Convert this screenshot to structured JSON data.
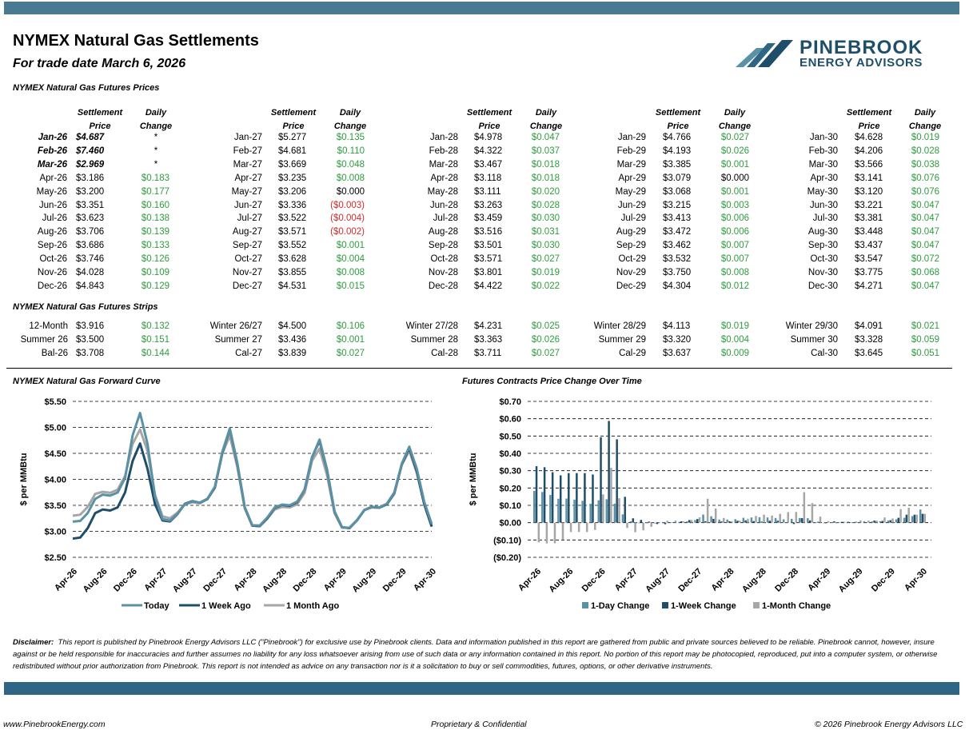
{
  "header": {
    "title": "NYMEX Natural Gas Settlements",
    "subtitle": "For trade date March 6, 2026",
    "brand": "PINEBROOK",
    "brand_tag": "ENERGY ADVISORS"
  },
  "prices": {
    "section_title": "NYMEX Natural Gas Futures Prices",
    "col_headers": {
      "settle1": "Settlement",
      "settle2": "Price",
      "change1": "Daily",
      "change2": "Change"
    },
    "columns": [
      {
        "rows": [
          {
            "label": "Jan-26",
            "price": "$4.687",
            "change": "*",
            "expired": true
          },
          {
            "label": "Feb-26",
            "price": "$7.460",
            "change": "*",
            "expired": true
          },
          {
            "label": "Mar-26",
            "price": "$2.969",
            "change": "*",
            "expired": true
          },
          {
            "label": "Apr-26",
            "price": "$3.186",
            "change": "$0.183"
          },
          {
            "label": "May-26",
            "price": "$3.200",
            "change": "$0.177"
          },
          {
            "label": "Jun-26",
            "price": "$3.351",
            "change": "$0.160"
          },
          {
            "label": "Jul-26",
            "price": "$3.623",
            "change": "$0.138"
          },
          {
            "label": "Aug-26",
            "price": "$3.706",
            "change": "$0.139"
          },
          {
            "label": "Sep-26",
            "price": "$3.686",
            "change": "$0.133"
          },
          {
            "label": "Oct-26",
            "price": "$3.746",
            "change": "$0.126"
          },
          {
            "label": "Nov-26",
            "price": "$4.028",
            "change": "$0.109"
          },
          {
            "label": "Dec-26",
            "price": "$4.843",
            "change": "$0.129"
          }
        ]
      },
      {
        "rows": [
          {
            "label": "Jan-27",
            "price": "$5.277",
            "change": "$0.135"
          },
          {
            "label": "Feb-27",
            "price": "$4.681",
            "change": "$0.110"
          },
          {
            "label": "Mar-27",
            "price": "$3.669",
            "change": "$0.048"
          },
          {
            "label": "Apr-27",
            "price": "$3.235",
            "change": "$0.008"
          },
          {
            "label": "May-27",
            "price": "$3.206",
            "change": "$0.000"
          },
          {
            "label": "Jun-27",
            "price": "$3.336",
            "change": "($0.003)"
          },
          {
            "label": "Jul-27",
            "price": "$3.522",
            "change": "($0.004)"
          },
          {
            "label": "Aug-27",
            "price": "$3.571",
            "change": "($0.002)"
          },
          {
            "label": "Sep-27",
            "price": "$3.552",
            "change": "$0.001"
          },
          {
            "label": "Oct-27",
            "price": "$3.628",
            "change": "$0.004"
          },
          {
            "label": "Nov-27",
            "price": "$3.855",
            "change": "$0.008"
          },
          {
            "label": "Dec-27",
            "price": "$4.531",
            "change": "$0.015"
          }
        ]
      },
      {
        "rows": [
          {
            "label": "Jan-28",
            "price": "$4.978",
            "change": "$0.047"
          },
          {
            "label": "Feb-28",
            "price": "$4.322",
            "change": "$0.037"
          },
          {
            "label": "Mar-28",
            "price": "$3.467",
            "change": "$0.018"
          },
          {
            "label": "Apr-28",
            "price": "$3.118",
            "change": "$0.018"
          },
          {
            "label": "May-28",
            "price": "$3.111",
            "change": "$0.020"
          },
          {
            "label": "Jun-28",
            "price": "$3.263",
            "change": "$0.028"
          },
          {
            "label": "Jul-28",
            "price": "$3.459",
            "change": "$0.030"
          },
          {
            "label": "Aug-28",
            "price": "$3.516",
            "change": "$0.031"
          },
          {
            "label": "Sep-28",
            "price": "$3.501",
            "change": "$0.030"
          },
          {
            "label": "Oct-28",
            "price": "$3.571",
            "change": "$0.027"
          },
          {
            "label": "Nov-28",
            "price": "$3.801",
            "change": "$0.019"
          },
          {
            "label": "Dec-28",
            "price": "$4.422",
            "change": "$0.022"
          }
        ]
      },
      {
        "rows": [
          {
            "label": "Jan-29",
            "price": "$4.766",
            "change": "$0.027"
          },
          {
            "label": "Feb-29",
            "price": "$4.193",
            "change": "$0.026"
          },
          {
            "label": "Mar-29",
            "price": "$3.385",
            "change": "$0.001"
          },
          {
            "label": "Apr-29",
            "price": "$3.079",
            "change": "$0.000"
          },
          {
            "label": "May-29",
            "price": "$3.068",
            "change": "$0.001"
          },
          {
            "label": "Jun-29",
            "price": "$3.215",
            "change": "$0.003"
          },
          {
            "label": "Jul-29",
            "price": "$3.413",
            "change": "$0.006"
          },
          {
            "label": "Aug-29",
            "price": "$3.472",
            "change": "$0.006"
          },
          {
            "label": "Sep-29",
            "price": "$3.462",
            "change": "$0.007"
          },
          {
            "label": "Oct-29",
            "price": "$3.532",
            "change": "$0.007"
          },
          {
            "label": "Nov-29",
            "price": "$3.750",
            "change": "$0.008"
          },
          {
            "label": "Dec-29",
            "price": "$4.304",
            "change": "$0.012"
          }
        ]
      },
      {
        "rows": [
          {
            "label": "Jan-30",
            "price": "$4.628",
            "change": "$0.019"
          },
          {
            "label": "Feb-30",
            "price": "$4.206",
            "change": "$0.028"
          },
          {
            "label": "Mar-30",
            "price": "$3.566",
            "change": "$0.038"
          },
          {
            "label": "Apr-30",
            "price": "$3.141",
            "change": "$0.076"
          },
          {
            "label": "May-30",
            "price": "$3.120",
            "change": "$0.076"
          },
          {
            "label": "Jun-30",
            "price": "$3.221",
            "change": "$0.047"
          },
          {
            "label": "Jul-30",
            "price": "$3.381",
            "change": "$0.047"
          },
          {
            "label": "Aug-30",
            "price": "$3.448",
            "change": "$0.047"
          },
          {
            "label": "Sep-30",
            "price": "$3.437",
            "change": "$0.047"
          },
          {
            "label": "Oct-30",
            "price": "$3.547",
            "change": "$0.072"
          },
          {
            "label": "Nov-30",
            "price": "$3.775",
            "change": "$0.068"
          },
          {
            "label": "Dec-30",
            "price": "$4.271",
            "change": "$0.047"
          }
        ]
      }
    ]
  },
  "strips": {
    "section_title": "NYMEX Natural Gas Futures Strips",
    "columns": [
      {
        "rows": [
          {
            "label": "12-Month",
            "price": "$3.916",
            "change": "$0.132"
          },
          {
            "label": "Summer 26",
            "price": "$3.500",
            "change": "$0.151"
          },
          {
            "label": "Bal-26",
            "price": "$3.708",
            "change": "$0.144"
          }
        ]
      },
      {
        "rows": [
          {
            "label": "Winter 26/27",
            "price": "$4.500",
            "change": "$0.106"
          },
          {
            "label": "Summer 27",
            "price": "$3.436",
            "change": "$0.001"
          },
          {
            "label": "Cal-27",
            "price": "$3.839",
            "change": "$0.027"
          }
        ]
      },
      {
        "rows": [
          {
            "label": "Winter 27/28",
            "price": "$4.231",
            "change": "$0.025"
          },
          {
            "label": "Summer 28",
            "price": "$3.363",
            "change": "$0.026"
          },
          {
            "label": "Cal-28",
            "price": "$3.711",
            "change": "$0.027"
          }
        ]
      },
      {
        "rows": [
          {
            "label": "Winter 28/29",
            "price": "$4.113",
            "change": "$0.019"
          },
          {
            "label": "Summer 29",
            "price": "$3.320",
            "change": "$0.004"
          },
          {
            "label": "Cal-29",
            "price": "$3.637",
            "change": "$0.009"
          }
        ]
      },
      {
        "rows": [
          {
            "label": "Winter 29/30",
            "price": "$4.091",
            "change": "$0.021"
          },
          {
            "label": "Summer 30",
            "price": "$3.328",
            "change": "$0.059"
          },
          {
            "label": "Cal-30",
            "price": "$3.645",
            "change": "$0.051"
          }
        ]
      }
    ]
  },
  "colors": {
    "today": "#5b91a5",
    "week": "#1f4e6b",
    "month": "#a6a6a6",
    "positive": "#2e9c3e",
    "negative": "#d42a2a",
    "bar1": "#5b91a5",
    "bar2": "#1f4e6b",
    "bar3": "#a6a6a6"
  },
  "chart_data": [
    {
      "type": "line",
      "title": "NYMEX Natural Gas Forward Curve",
      "ylabel": "$ per MMBtu",
      "ylim": [
        2.5,
        5.5
      ],
      "yticks": [
        "$2.50",
        "$3.00",
        "$3.50",
        "$4.00",
        "$4.50",
        "$5.00",
        "$5.50"
      ],
      "xticks": [
        "Apr-26",
        "Aug-26",
        "Dec-26",
        "Apr-27",
        "Aug-27",
        "Dec-27",
        "Apr-28",
        "Aug-28",
        "Dec-28",
        "Apr-29",
        "Aug-29",
        "Dec-29",
        "Apr-30"
      ],
      "grid": "horizontal dashed",
      "legend": "bottom",
      "series": [
        {
          "name": "Today",
          "values": [
            3.186,
            3.2,
            3.351,
            3.623,
            3.706,
            3.686,
            3.746,
            4.028,
            4.843,
            5.277,
            4.681,
            3.669,
            3.235,
            3.206,
            3.336,
            3.522,
            3.571,
            3.552,
            3.628,
            3.855,
            4.531,
            4.978,
            4.322,
            3.467,
            3.118,
            3.111,
            3.263,
            3.459,
            3.516,
            3.501,
            3.571,
            3.801,
            4.422,
            4.766,
            4.193,
            3.385,
            3.079,
            3.068,
            3.215,
            3.413,
            3.472,
            3.462,
            3.532,
            3.75,
            4.304,
            4.628,
            4.206,
            3.566,
            3.141
          ]
        },
        {
          "name": "1 Week Ago",
          "values": [
            2.86,
            2.88,
            3.06,
            3.35,
            3.42,
            3.4,
            3.46,
            3.75,
            4.35,
            4.69,
            4.2,
            3.52,
            3.21,
            3.19,
            3.33,
            3.53,
            3.58,
            3.55,
            3.62,
            3.84,
            4.51,
            4.97,
            4.3,
            3.46,
            3.11,
            3.1,
            3.25,
            3.45,
            3.51,
            3.49,
            3.56,
            3.8,
            4.43,
            4.74,
            4.18,
            3.38,
            3.08,
            3.06,
            3.21,
            3.41,
            3.47,
            3.46,
            3.52,
            3.74,
            4.29,
            4.6,
            4.16,
            3.52,
            3.09
          ]
        },
        {
          "name": "1 Month Ago",
          "values": [
            3.3,
            3.32,
            3.47,
            3.72,
            3.76,
            3.74,
            3.8,
            4.07,
            4.68,
            4.96,
            4.54,
            3.7,
            3.29,
            3.25,
            3.36,
            3.52,
            3.56,
            3.54,
            3.62,
            3.84,
            4.5,
            4.84,
            4.24,
            3.44,
            3.11,
            3.1,
            3.24,
            3.42,
            3.47,
            3.46,
            3.52,
            3.74,
            4.36,
            4.59,
            4.08,
            3.35,
            3.07,
            3.07,
            3.21,
            3.41,
            3.46,
            3.45,
            3.52,
            3.72,
            4.28,
            4.55,
            4.12,
            3.52,
            3.09
          ]
        }
      ]
    },
    {
      "type": "bar",
      "title": "Futures Contracts Price Change Over Time",
      "ylabel": "$ per MMBtu",
      "ylim": [
        -0.2,
        0.7
      ],
      "yticks": [
        "($0.20)",
        "($0.10)",
        "$0.00",
        "$0.10",
        "$0.20",
        "$0.30",
        "$0.40",
        "$0.50",
        "$0.60",
        "$0.70"
      ],
      "xticks": [
        "Apr-26",
        "Aug-26",
        "Dec-26",
        "Apr-27",
        "Aug-27",
        "Dec-27",
        "Apr-28",
        "Aug-28",
        "Dec-28",
        "Apr-29",
        "Aug-29",
        "Dec-29",
        "Apr-30"
      ],
      "grid": "horizontal dashed",
      "legend": "bottom",
      "series": [
        {
          "name": "1-Day Change",
          "values": [
            0.183,
            0.177,
            0.16,
            0.138,
            0.139,
            0.133,
            0.126,
            0.109,
            0.129,
            0.135,
            0.11,
            0.048,
            0.008,
            0.0,
            -0.003,
            -0.004,
            -0.002,
            0.001,
            0.004,
            0.008,
            0.015,
            0.047,
            0.037,
            0.018,
            0.018,
            0.02,
            0.028,
            0.03,
            0.031,
            0.03,
            0.027,
            0.019,
            0.022,
            0.027,
            0.026,
            0.001,
            0.0,
            0.001,
            0.003,
            0.006,
            0.006,
            0.007,
            0.007,
            0.008,
            0.012,
            0.019,
            0.028,
            0.038,
            0.076
          ]
        },
        {
          "name": "1-Week Change",
          "values": [
            0.326,
            0.32,
            0.291,
            0.273,
            0.286,
            0.286,
            0.286,
            0.278,
            0.493,
            0.587,
            0.481,
            0.149,
            0.025,
            0.016,
            0.006,
            -0.008,
            -0.009,
            0.002,
            0.008,
            0.015,
            0.021,
            0.008,
            0.022,
            0.007,
            0.008,
            0.011,
            0.013,
            0.009,
            0.006,
            0.011,
            0.011,
            0.001,
            -0.008,
            0.026,
            0.013,
            0.005,
            -0.001,
            0.008,
            0.005,
            0.003,
            0.002,
            0.002,
            0.012,
            0.01,
            0.014,
            0.028,
            0.046,
            0.046,
            0.051
          ]
        },
        {
          "name": "1-Month Change",
          "values": [
            -0.114,
            -0.12,
            -0.119,
            -0.097,
            -0.054,
            -0.054,
            -0.054,
            -0.042,
            0.163,
            0.317,
            0.141,
            -0.031,
            -0.055,
            -0.044,
            -0.024,
            0.002,
            0.011,
            0.012,
            0.008,
            0.015,
            0.031,
            0.138,
            0.082,
            0.027,
            0.008,
            0.011,
            0.023,
            0.039,
            0.046,
            0.041,
            0.051,
            0.061,
            0.062,
            0.176,
            0.113,
            0.035,
            0.009,
            -0.002,
            0.005,
            0.003,
            0.012,
            0.012,
            0.012,
            0.03,
            0.024,
            0.078,
            0.086,
            0.046,
            0.051
          ]
        }
      ]
    }
  ],
  "disclaimer": {
    "label": "Disclaimer:",
    "text": "This report is published by Pinebrook Energy Advisors LLC (\"Pinebrook\") for exclusive use by Pinebrook clients.  Data and information published in this report are gathered from public and private sources believed to be reliable.  Pinebrook cannot, however, insure against or be held responsible for inaccuracies and further assumes no liability for any loss whatsoever arising from use of such data or any information contained in this report.  No portion of this report may be photocopied, reproduced, put into a computer system, or otherwise redistributed without prior authorization from Pinebrook.  This report is not intended as advice on any transaction nor is it a solicitation to buy or sell commodities, futures, options, or other derivative instruments."
  },
  "footer": {
    "left": "www.PinebrookEnergy.com",
    "center": "Proprietary & Confidential",
    "right": "© 2026 Pinebrook Energy Advisors LLC"
  }
}
